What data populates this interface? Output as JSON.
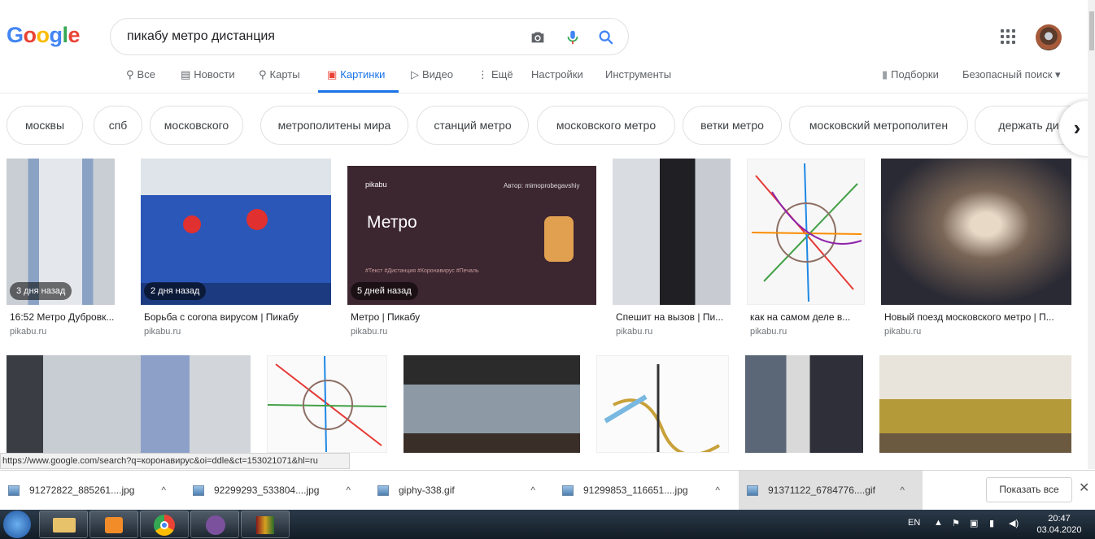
{
  "logo": {
    "letters": [
      "G",
      "o",
      "o",
      "g",
      "l",
      "e"
    ],
    "colors": [
      "#4285f4",
      "#ea4335",
      "#fbbc05",
      "#4285f4",
      "#34a853",
      "#ea4335"
    ]
  },
  "search": {
    "query": "пикабу метро дистанция"
  },
  "tabs": [
    "Все",
    "Новости",
    "Карты",
    "Картинки",
    "Видео",
    "Ещё",
    "Настройки",
    "Инструменты"
  ],
  "right_links": {
    "collections": "Подборки",
    "safe_search": "Безопасный поиск"
  },
  "chips": [
    "москвы",
    "спб",
    "московского",
    "метрополитены мира",
    "станций метро",
    "московского метро",
    "ветки метро",
    "московский метрополитен",
    "держать дис"
  ],
  "results_row1": [
    {
      "badge": "3 дня назад",
      "caption": "16:52 Метро Дубровк...",
      "source": "pikabu.ru"
    },
    {
      "badge": "2 дня назад",
      "caption": "Борьба с corona вирусом | Пикабу",
      "source": "pikabu.ru"
    },
    {
      "badge": "5 дней назад",
      "caption": "Метро | Пикабу",
      "source": "pikabu.ru"
    },
    {
      "badge": "",
      "caption": "Спешит на вызов | Пи...",
      "source": "pikabu.ru"
    },
    {
      "badge": "",
      "caption": "как на самом деле в...",
      "source": "pikabu.ru"
    },
    {
      "badge": "",
      "caption": "Новый поезд московского метро | П...",
      "source": "pikabu.ru"
    }
  ],
  "pikabu_card": {
    "brand": "pikabu",
    "author": "Автор: mimoprobegavshiy",
    "title": "Метро",
    "tags": "#Текст   #Дистанция   #Коронавирус   #Печаль"
  },
  "status_url": "https://www.google.com/search?q=коронавирус&oi=ddle&ct=153021071&hl=ru",
  "downloads": [
    "91272822_885261....jpg",
    "92299293_533804....jpg",
    "giphy-338.gif",
    "91299853_116651....jpg",
    "91371122_6784776....gif"
  ],
  "show_all": "Показать все",
  "tray": {
    "lang": "EN",
    "time": "20:47",
    "date": "03.04.2020"
  }
}
